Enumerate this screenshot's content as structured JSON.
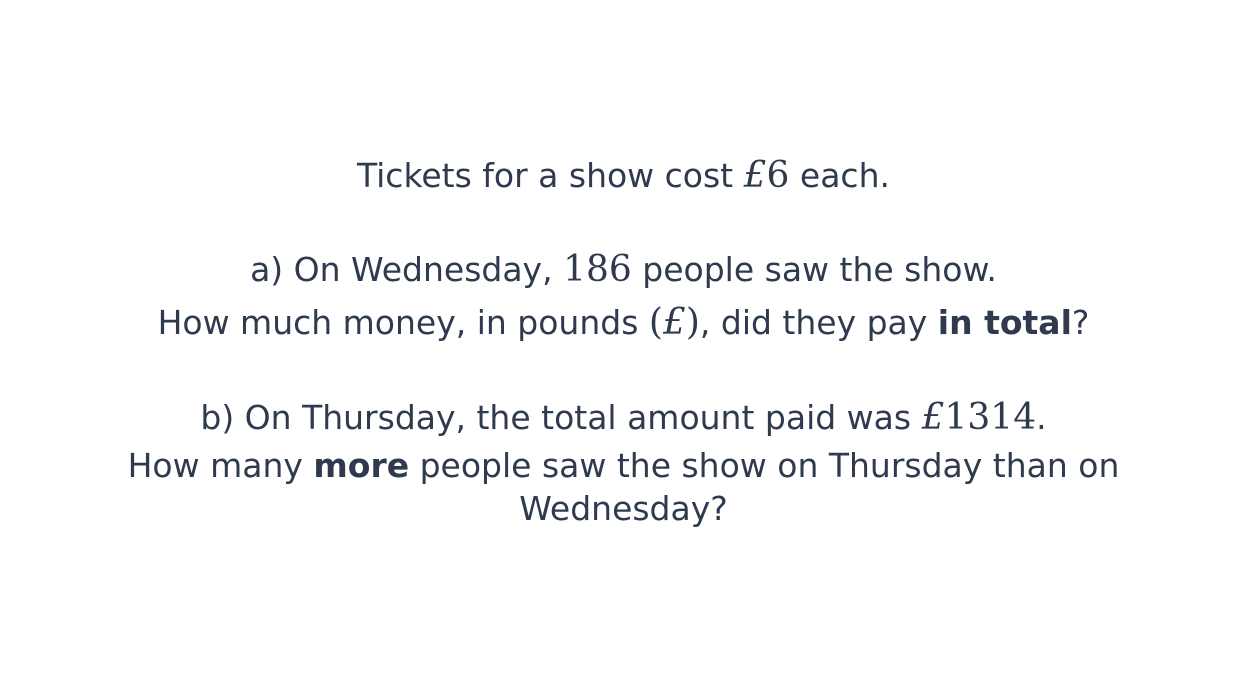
{
  "intro": {
    "text_before": "Tickets for a show cost ",
    "price_symbol": "£",
    "price_value": "6",
    "text_after": " each."
  },
  "question_a": {
    "line1_before": "a) On Wednesday, ",
    "line1_number": "186",
    "line1_after": " people saw the show.",
    "line2_before": "How much money, in pounds ",
    "line2_paren_open": "(",
    "line2_symbol": "£",
    "line2_paren_close": ")",
    "line2_mid": ", did they pay ",
    "line2_bold": "in total",
    "line2_after": "?"
  },
  "question_b": {
    "line1_before": "b) On Thursday, the total amount paid was ",
    "line1_symbol": "£",
    "line1_number": "1314",
    "line1_after": ".",
    "line2_before": "How many ",
    "line2_bold": "more",
    "line2_after": " people saw the show on Thursday than on",
    "line3": "Wednesday?"
  }
}
